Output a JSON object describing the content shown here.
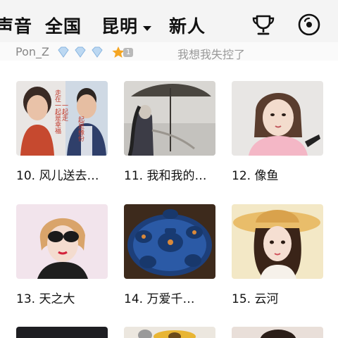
{
  "header": {
    "tabs": [
      {
        "label": "声音"
      },
      {
        "label": "全国"
      },
      {
        "label": "昆明"
      },
      {
        "label": "新人"
      }
    ],
    "active_tab": "昆明",
    "accent_color": "#f0413e",
    "icons": [
      "trophy-icon",
      "record-icon"
    ]
  },
  "subheader": {
    "username": "Pon_Z",
    "level": "1",
    "slogan": "我想我失控了",
    "icons": [
      "diamond-icon",
      "diamond-icon",
      "diamond-icon",
      "star-icon"
    ]
  },
  "grid": {
    "items": [
      {
        "caption": "10. 风儿送去…",
        "thumb_text": [
          "一起走",
          "走在一起是幸福",
          "起是缘份"
        ]
      },
      {
        "caption": "11. 我和我的…"
      },
      {
        "caption": "12. 像鱼"
      },
      {
        "caption": "13. 天之大"
      },
      {
        "caption": "14. 万爱千…"
      },
      {
        "caption": "15. 云河"
      }
    ]
  }
}
